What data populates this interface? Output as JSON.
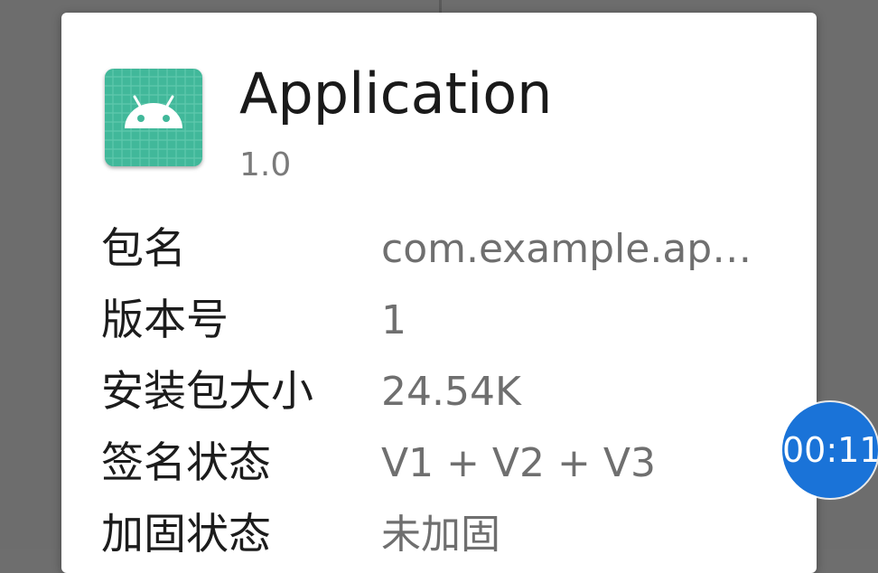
{
  "app": {
    "name": "Application",
    "version": "1.0",
    "icon": "android-icon",
    "icon_color": "#41b89a"
  },
  "info_rows": [
    {
      "label": "包名",
      "value": "com.example.ap…"
    },
    {
      "label": "版本号",
      "value": "1"
    },
    {
      "label": "安装包大小",
      "value": "24.54K"
    },
    {
      "label": "签名状态",
      "value": "V1 + V2 + V3"
    },
    {
      "label": "加固状态",
      "value": "未加固"
    }
  ],
  "timer": {
    "text": "00:11",
    "color": "#1a73d8"
  }
}
